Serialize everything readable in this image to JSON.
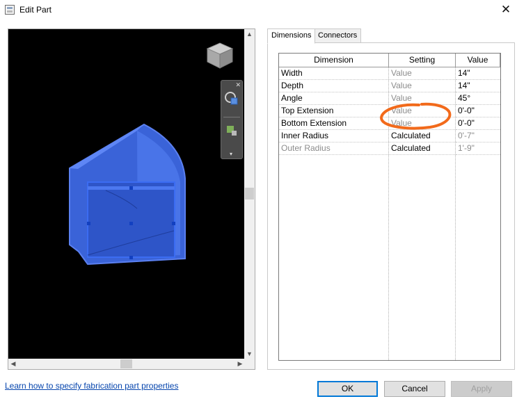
{
  "window": {
    "title": "Edit Part",
    "close_glyph": "✕"
  },
  "tabs": [
    {
      "label": "Dimensions",
      "active": true
    },
    {
      "label": "Connectors",
      "active": false
    }
  ],
  "grid": {
    "headers": [
      "Dimension",
      "Setting",
      "Value"
    ],
    "rows": [
      {
        "dimension": "Width",
        "setting": "Value",
        "value": "14\"",
        "greyed_setting": true,
        "greyed_value": false,
        "greyed_dimension": false
      },
      {
        "dimension": "Depth",
        "setting": "Value",
        "value": "14\"",
        "greyed_setting": true,
        "greyed_value": false,
        "greyed_dimension": false
      },
      {
        "dimension": "Angle",
        "setting": "Value",
        "value": "45°",
        "greyed_setting": true,
        "greyed_value": false,
        "greyed_dimension": false
      },
      {
        "dimension": "Top Extension",
        "setting": "Value",
        "value": "0'-0\"",
        "greyed_setting": true,
        "greyed_value": false,
        "greyed_dimension": false
      },
      {
        "dimension": "Bottom Extension",
        "setting": "Value",
        "value": "0'-0\"",
        "greyed_setting": true,
        "greyed_value": false,
        "greyed_dimension": false
      },
      {
        "dimension": "Inner Radius",
        "setting": "Calculated",
        "value": "0'-7\"",
        "greyed_setting": false,
        "greyed_value": true,
        "greyed_dimension": false
      },
      {
        "dimension": "Outer Radius",
        "setting": "Calculated",
        "value": "1'-9\"",
        "greyed_setting": false,
        "greyed_value": true,
        "greyed_dimension": true
      }
    ]
  },
  "footer": {
    "help_link": "Learn how to specify fabrication part properties",
    "ok_label": "OK",
    "cancel_label": "Cancel",
    "apply_label": "Apply"
  },
  "colors": {
    "part_fill": "#3a63d8",
    "canvas_bg": "#000000",
    "highlight_stroke": "#f26a1b",
    "greyed_text": "#8c8c8c",
    "default_button_border": "#0078d7"
  },
  "icons": {
    "close": "close-icon",
    "app": "app-window-icon",
    "viewcube": "viewcube-icon",
    "steering_wheel": "steering-wheel-icon",
    "zoom": "zoom-icon"
  }
}
